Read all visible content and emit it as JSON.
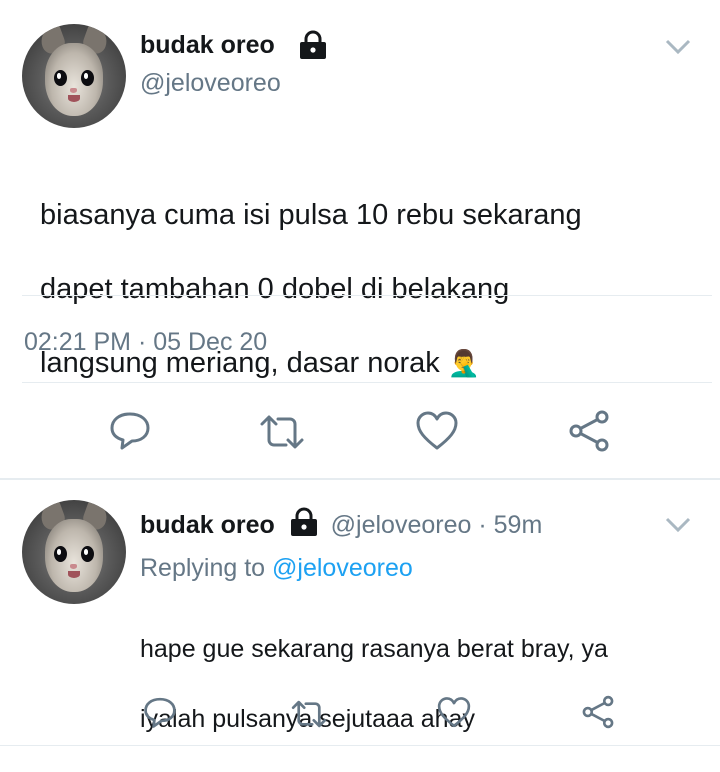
{
  "main_tweet": {
    "display_name": "budak oreo",
    "handle": "@jeloveoreo",
    "text_lines": [
      "biasanya cuma isi pulsa 10 rebu sekarang",
      "dapet tambahan 0 dobel di belakang",
      "langsung meriang, dasar norak"
    ],
    "emoji": "🤦‍♂️",
    "time": "02:21 PM",
    "separator": "·",
    "date": "05 Dec 20"
  },
  "reply_tweet": {
    "display_name": "budak oreo",
    "handle": "@jeloveoreo",
    "age": "· 59m",
    "replying_prefix": "Replying to",
    "replying_to": "@jeloveoreo",
    "text_lines": [
      "hape gue sekarang rasanya berat bray, ya",
      "iyalah pulsanya sejutaaa ahay"
    ]
  },
  "icons": {
    "lock": "lock-icon",
    "chevron": "chevron-down-icon",
    "reply": "reply-icon",
    "retweet": "retweet-icon",
    "like": "heart-icon",
    "share": "share-icon"
  },
  "colors": {
    "text": "#14171a",
    "secondary": "#657786",
    "icon_gray": "#657786",
    "chevron_gray": "#aab8c2",
    "link_blue": "#1da1f2",
    "divider": "#e6ecf0"
  }
}
